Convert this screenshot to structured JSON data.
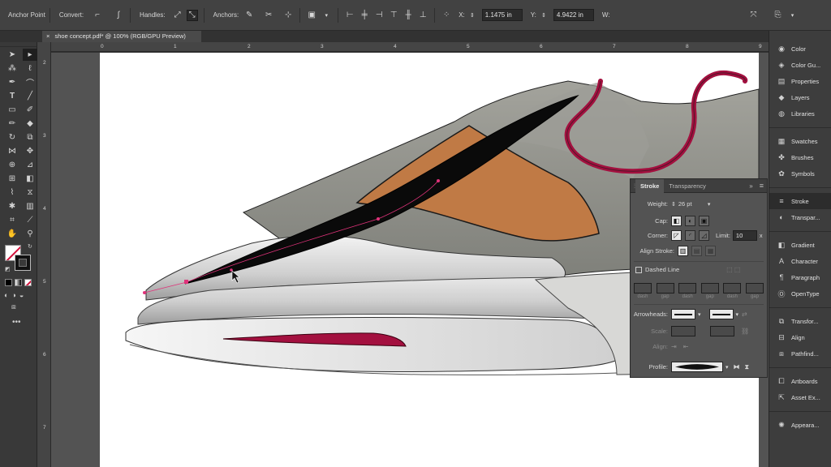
{
  "control_bar": {
    "anchor_point_label": "Anchor Point",
    "convert_label": "Convert:",
    "handles_label": "Handles:",
    "anchors_label": "Anchors:",
    "x_label": "X:",
    "x_value": "1.1475 in",
    "y_label": "Y:",
    "y_value": "4.9422 in",
    "w_label": "W:"
  },
  "document_tab": {
    "title": "shoe concept.pdf* @ 100% (RGB/GPU Preview)",
    "close": "×"
  },
  "rulers": {
    "top": [
      "0",
      "1",
      "2",
      "3",
      "4",
      "5",
      "6",
      "7",
      "8",
      "9"
    ],
    "left": [
      "2",
      "3",
      "4",
      "5",
      "6",
      "7"
    ]
  },
  "dock": {
    "items": [
      {
        "label": "Color",
        "icon": "color-icon"
      },
      {
        "label": "Color Gu...",
        "icon": "color-guide-icon"
      },
      {
        "label": "Properties",
        "icon": "properties-icon"
      },
      {
        "label": "Layers",
        "icon": "layers-icon"
      },
      {
        "label": "Libraries",
        "icon": "libraries-icon"
      },
      {
        "label": "Swatches",
        "icon": "swatches-icon"
      },
      {
        "label": "Brushes",
        "icon": "brushes-icon"
      },
      {
        "label": "Symbols",
        "icon": "symbols-icon"
      },
      {
        "label": "Stroke",
        "icon": "stroke-icon"
      },
      {
        "label": "Transpar...",
        "icon": "transparency-icon"
      },
      {
        "label": "Gradient",
        "icon": "gradient-icon"
      },
      {
        "label": "Character",
        "icon": "character-icon"
      },
      {
        "label": "Paragraph",
        "icon": "paragraph-icon"
      },
      {
        "label": "OpenType",
        "icon": "opentype-icon"
      },
      {
        "label": "Transfor...",
        "icon": "transform-icon"
      },
      {
        "label": "Align",
        "icon": "align-icon"
      },
      {
        "label": "Pathfind...",
        "icon": "pathfinder-icon"
      },
      {
        "label": "Artboards",
        "icon": "artboards-icon"
      },
      {
        "label": "Asset Ex...",
        "icon": "asset-export-icon"
      },
      {
        "label": "Appeara...",
        "icon": "appearance-icon"
      }
    ]
  },
  "stroke_panel": {
    "tab_stroke": "Stroke",
    "tab_transparency": "Transparency",
    "weight_label": "Weight:",
    "weight_value": "26 pt",
    "cap_label": "Cap:",
    "corner_label": "Corner:",
    "limit_label": "Limit:",
    "limit_value": "10",
    "limit_unit": "x",
    "align_stroke_label": "Align Stroke:",
    "dashed_line_label": "Dashed Line",
    "dash_gap_labels": [
      "dash",
      "gap",
      "dash",
      "gap",
      "dash",
      "gap"
    ],
    "arrowheads_label": "Arrowheads:",
    "scale_label": "Scale:",
    "align_label": "Align:",
    "profile_label": "Profile:"
  },
  "colors": {
    "accent_crimson": "#a3103f",
    "leather_brown": "#c07a45",
    "sole_gray": "#d6d6d6",
    "upper_gray": "#8e8e88"
  }
}
